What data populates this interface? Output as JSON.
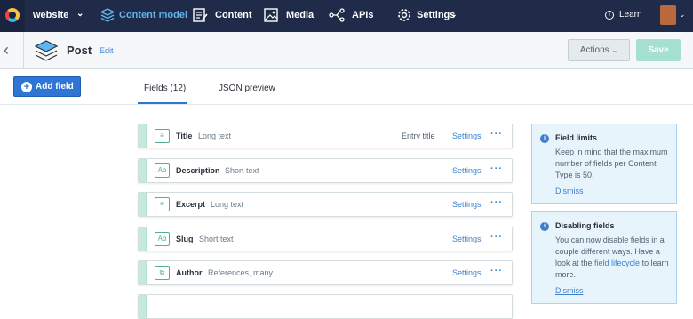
{
  "topbar": {
    "space_name": "website",
    "nav": [
      {
        "label": "Content model",
        "icon": "content-model-icon"
      },
      {
        "label": "Content",
        "icon": "content-icon"
      },
      {
        "label": "Media",
        "icon": "media-icon"
      },
      {
        "label": "APIs",
        "icon": "apis-icon"
      },
      {
        "label": "Settings",
        "icon": "settings-icon"
      }
    ],
    "learn_label": "Learn"
  },
  "header": {
    "title": "Post",
    "edit_label": "Edit",
    "actions_label": "Actions",
    "save_label": "Save"
  },
  "toolbar": {
    "add_field_label": "Add field",
    "tabs": [
      {
        "label": "Fields (12)",
        "active": true
      },
      {
        "label": "JSON preview",
        "active": false
      }
    ]
  },
  "fields": [
    {
      "name": "Title",
      "type": "Long text",
      "icon": "long-text-icon",
      "badge": "Entry title",
      "settings": "Settings",
      "more": "···"
    },
    {
      "name": "Description",
      "type": "Short text",
      "icon": "short-text-icon",
      "badge": "",
      "settings": "Settings",
      "more": "···"
    },
    {
      "name": "Excerpt",
      "type": "Long text",
      "icon": "long-text-icon",
      "badge": "",
      "settings": "Settings",
      "more": "···"
    },
    {
      "name": "Slug",
      "type": "Short text",
      "icon": "short-text-icon",
      "badge": "",
      "settings": "Settings",
      "more": "···"
    },
    {
      "name": "Author",
      "type": "References, many",
      "icon": "reference-icon",
      "badge": "",
      "settings": "Settings",
      "more": "···"
    }
  ],
  "notes": [
    {
      "title": "Field limits",
      "body": "Keep in mind that the maximum number of fields per Content Type is 50.",
      "dismiss": "Dismiss"
    },
    {
      "title": "Disabling fields",
      "body_before": "You can now disable fields in a couple different ways. Have a look at the ",
      "link": "field lifecycle",
      "body_after": " to learn more.",
      "dismiss": "Dismiss"
    }
  ],
  "colors": {
    "topbar": "#1f2b48",
    "accent": "#2e75d4",
    "field_accent": "#51b28d",
    "save_disabled": "#a6e0ce"
  }
}
